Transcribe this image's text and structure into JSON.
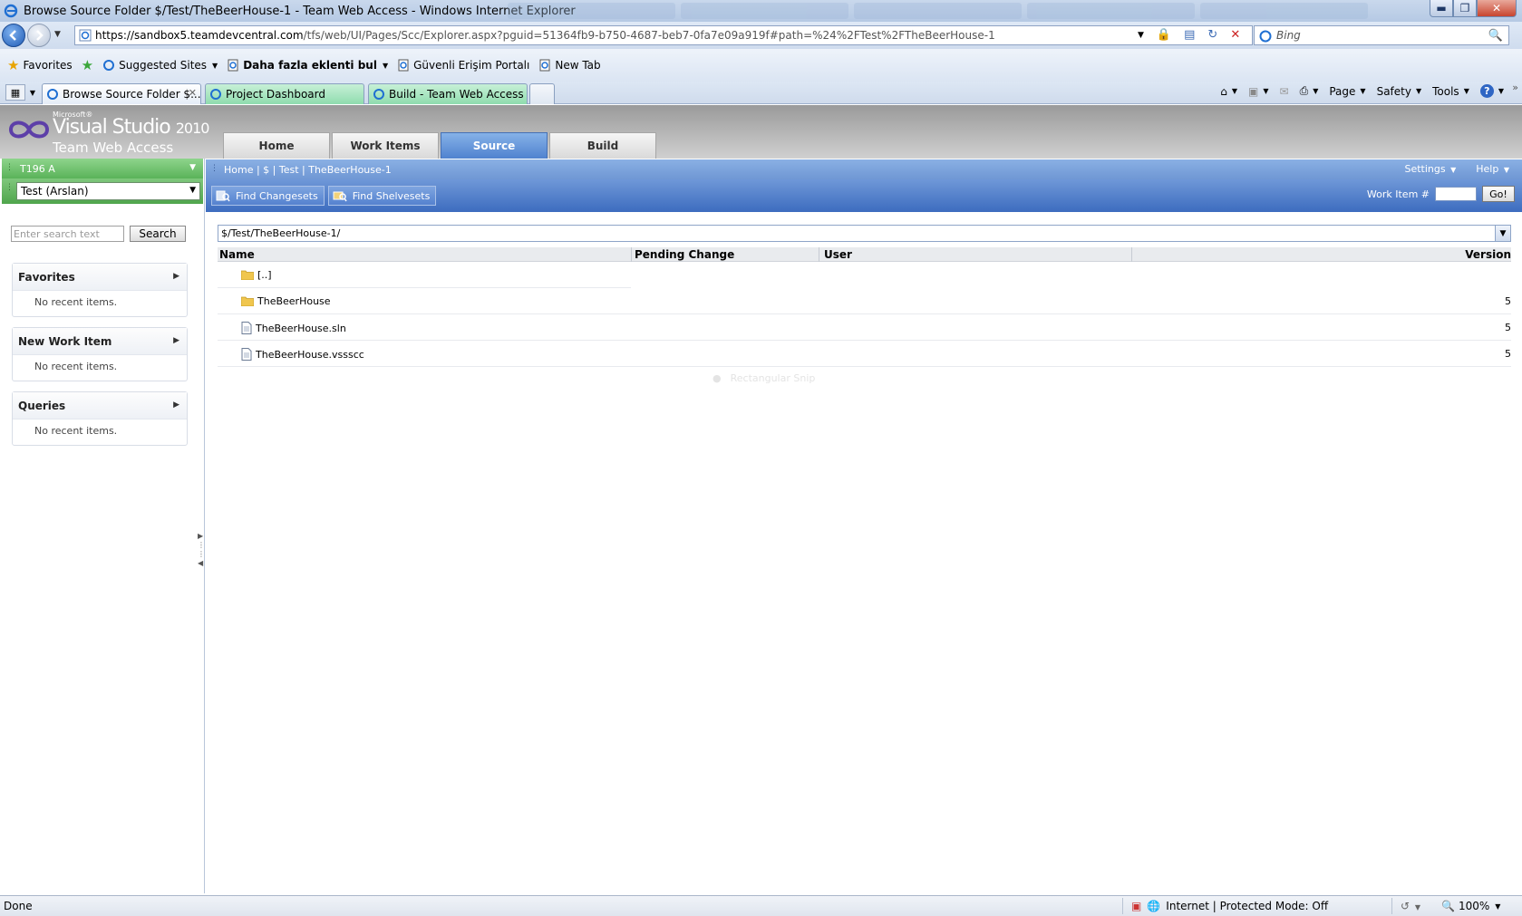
{
  "window": {
    "title": "Browse Source Folder $/Test/TheBeerHouse-1 - Team Web Access - Windows Internet Explorer"
  },
  "address": {
    "host": "https://sandbox5.teamdevcentral.com",
    "path": "/tfs/web/UI/Pages/Scc/Explorer.aspx?pguid=51364fb9-b750-4687-beb7-0fa7e09a919f#path=%24%2FTest%2FTheBeerHouse-1",
    "search_placeholder": "Bing"
  },
  "favorites_bar": {
    "favorites_label": "Favorites",
    "items": [
      {
        "label": "Suggested Sites",
        "has_dropdown": true,
        "bold": false
      },
      {
        "label": "Daha fazla eklenti bul",
        "has_dropdown": true,
        "bold": true
      },
      {
        "label": "Güvenli Erişim Portalı",
        "has_dropdown": false,
        "bold": false
      },
      {
        "label": "New Tab",
        "has_dropdown": false,
        "bold": false
      }
    ]
  },
  "browser_tabs": [
    {
      "label": "Browse Source Folder $...",
      "active": true
    },
    {
      "label": "Project Dashboard",
      "active": false
    },
    {
      "label": "Build - Team Web Access",
      "active": false
    }
  ],
  "command_bar": {
    "page": "Page",
    "safety": "Safety",
    "tools": "Tools"
  },
  "product": {
    "microsoft": "Microsoft®",
    "visual_studio": "Visual Studio",
    "version": "2010",
    "team_web_access": "Team Web Access"
  },
  "main_tabs": [
    {
      "label": "Home",
      "active": false
    },
    {
      "label": "Work Items",
      "active": false
    },
    {
      "label": "Source",
      "active": true
    },
    {
      "label": "Build",
      "active": false
    }
  ],
  "left": {
    "collection": "T196 A",
    "project": "Test (Arslan)",
    "search_placeholder": "Enter search text",
    "search_button": "Search",
    "panels": [
      {
        "title": "Favorites",
        "body": "No recent items."
      },
      {
        "title": "New Work Item",
        "body": "No recent items."
      },
      {
        "title": "Queries",
        "body": "No recent items."
      }
    ]
  },
  "breadcrumb": {
    "text": "Home | $ | Test | TheBeerHouse-1",
    "settings": "Settings",
    "help": "Help"
  },
  "toolbar": {
    "find_changesets": "Find Changesets",
    "find_shelvesets": "Find Shelvesets",
    "work_item_label": "Work Item #",
    "go_button": "Go!"
  },
  "explorer": {
    "path": "$/Test/TheBeerHouse-1/",
    "columns": {
      "name": "Name",
      "pending_change": "Pending Change",
      "user": "User",
      "version": "Version"
    },
    "rows": [
      {
        "name": "[..]",
        "type": "folder",
        "version": ""
      },
      {
        "name": "TheBeerHouse",
        "type": "folder",
        "version": "5"
      },
      {
        "name": "TheBeerHouse.sln",
        "type": "file",
        "version": "5"
      },
      {
        "name": "TheBeerHouse.vssscc",
        "type": "file",
        "version": "5"
      }
    ]
  },
  "ghost_overlay": "Rectangular Snip",
  "status": {
    "left": "Done",
    "zone": "Internet | Protected Mode: Off",
    "zoom": "100%"
  },
  "colors": {
    "active_tab": "#4f82cf",
    "project_bar": "#5ab359",
    "toolbar": "#3d6cbf"
  }
}
